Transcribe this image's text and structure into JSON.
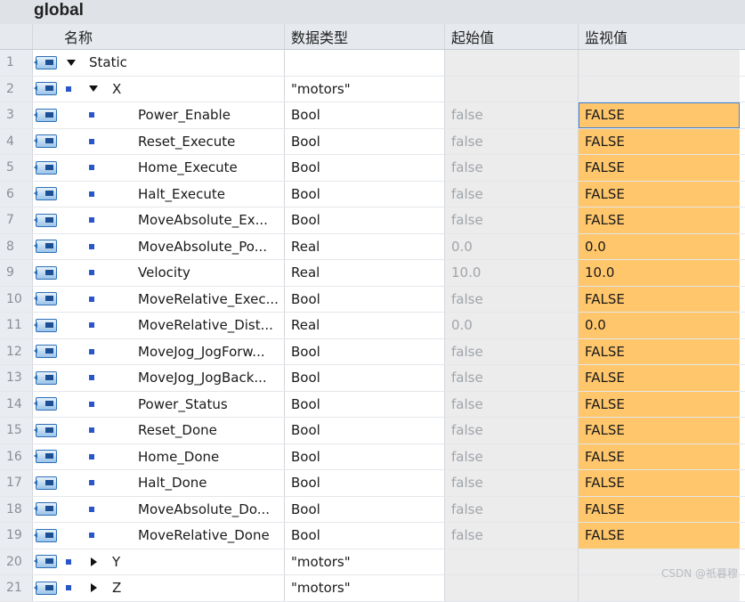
{
  "block_title": "global",
  "columns": {
    "name": "名称",
    "data_type": "数据类型",
    "start_value": "起始值",
    "monitor_value": "监视值"
  },
  "rows": [
    {
      "num": "1",
      "name": "Static",
      "type": "",
      "start": "",
      "monitor": ""
    },
    {
      "num": "2",
      "name": "X",
      "type": "\"motors\"",
      "start": "",
      "monitor": ""
    },
    {
      "num": "3",
      "name": "Power_Enable",
      "type": "Bool",
      "start": "false",
      "monitor": "FALSE"
    },
    {
      "num": "4",
      "name": "Reset_Execute",
      "type": "Bool",
      "start": "false",
      "monitor": "FALSE"
    },
    {
      "num": "5",
      "name": "Home_Execute",
      "type": "Bool",
      "start": "false",
      "monitor": "FALSE"
    },
    {
      "num": "6",
      "name": "Halt_Execute",
      "type": "Bool",
      "start": "false",
      "monitor": "FALSE"
    },
    {
      "num": "7",
      "name": "MoveAbsolute_Ex...",
      "type": "Bool",
      "start": "false",
      "monitor": "FALSE"
    },
    {
      "num": "8",
      "name": "MoveAbsolute_Po...",
      "type": "Real",
      "start": "0.0",
      "monitor": "0.0"
    },
    {
      "num": "9",
      "name": "Velocity",
      "type": "Real",
      "start": "10.0",
      "monitor": "10.0"
    },
    {
      "num": "10",
      "name": "MoveRelative_Exec...",
      "type": "Bool",
      "start": "false",
      "monitor": "FALSE"
    },
    {
      "num": "11",
      "name": "MoveRelative_Dist...",
      "type": "Real",
      "start": "0.0",
      "monitor": "0.0"
    },
    {
      "num": "12",
      "name": "MoveJog_JogForw...",
      "type": "Bool",
      "start": "false",
      "monitor": "FALSE"
    },
    {
      "num": "13",
      "name": "MoveJog_JogBack...",
      "type": "Bool",
      "start": "false",
      "monitor": "FALSE"
    },
    {
      "num": "14",
      "name": "Power_Status",
      "type": "Bool",
      "start": "false",
      "monitor": "FALSE"
    },
    {
      "num": "15",
      "name": "Reset_Done",
      "type": "Bool",
      "start": "false",
      "monitor": "FALSE"
    },
    {
      "num": "16",
      "name": "Home_Done",
      "type": "Bool",
      "start": "false",
      "monitor": "FALSE"
    },
    {
      "num": "17",
      "name": "Halt_Done",
      "type": "Bool",
      "start": "false",
      "monitor": "FALSE"
    },
    {
      "num": "18",
      "name": "MoveAbsolute_Do...",
      "type": "Bool",
      "start": "false",
      "monitor": "FALSE"
    },
    {
      "num": "19",
      "name": "MoveRelative_Done",
      "type": "Bool",
      "start": "false",
      "monitor": "FALSE"
    },
    {
      "num": "20",
      "name": "Y",
      "type": "\"motors\"",
      "start": "",
      "monitor": ""
    },
    {
      "num": "21",
      "name": "Z",
      "type": "\"motors\"",
      "start": "",
      "monitor": ""
    }
  ],
  "watermark": "CSDN @祇暮穆",
  "colors": {
    "monitor_highlight": "#ffc66b",
    "selection_border": "#3b7fd6",
    "icon_blue": "#2b6fb8"
  },
  "icons": {
    "row_icon": "db-tag-icon",
    "member_marker": "member-square-icon"
  }
}
